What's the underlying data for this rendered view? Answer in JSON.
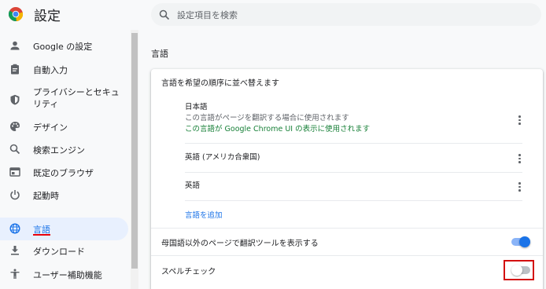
{
  "header": {
    "title": "設定",
    "search_placeholder": "設定項目を検索"
  },
  "sidebar": {
    "items": [
      {
        "label": "Google の設定",
        "icon": "person-icon"
      },
      {
        "label": "自動入力",
        "icon": "clipboard-icon"
      },
      {
        "label": "プライバシーとセキュリティ",
        "icon": "shield-icon"
      },
      {
        "label": "デザイン",
        "icon": "palette-icon"
      },
      {
        "label": "検索エンジン",
        "icon": "search-icon"
      },
      {
        "label": "既定のブラウザ",
        "icon": "browser-icon"
      },
      {
        "label": "起動時",
        "icon": "power-icon"
      },
      {
        "label": "言語",
        "icon": "globe-icon",
        "selected": true
      },
      {
        "label": "ダウンロード",
        "icon": "download-icon"
      },
      {
        "label": "ユーザー補助機能",
        "icon": "accessibility-icon"
      }
    ]
  },
  "main": {
    "section_title": "言語",
    "card": {
      "heading": "言語を希望の順序に並べ替えます",
      "languages": [
        {
          "name": "日本語",
          "desc": "この言語がページを翻訳する場合に使用されます",
          "ui_note": "この言語が Google Chrome UI の表示に使用されます"
        },
        {
          "name": "英語 (アメリカ合衆国)"
        },
        {
          "name": "英語"
        }
      ],
      "add_language": "言語を追加",
      "translate_setting": {
        "label": "母国語以外のページで翻訳ツールを表示する",
        "enabled": true
      },
      "spellcheck_setting": {
        "label": "スペルチェック",
        "enabled": false
      }
    }
  },
  "colors": {
    "accent": "#1a73e8",
    "ui_language_green": "#188038",
    "highlight_red": "#d30f0f"
  }
}
